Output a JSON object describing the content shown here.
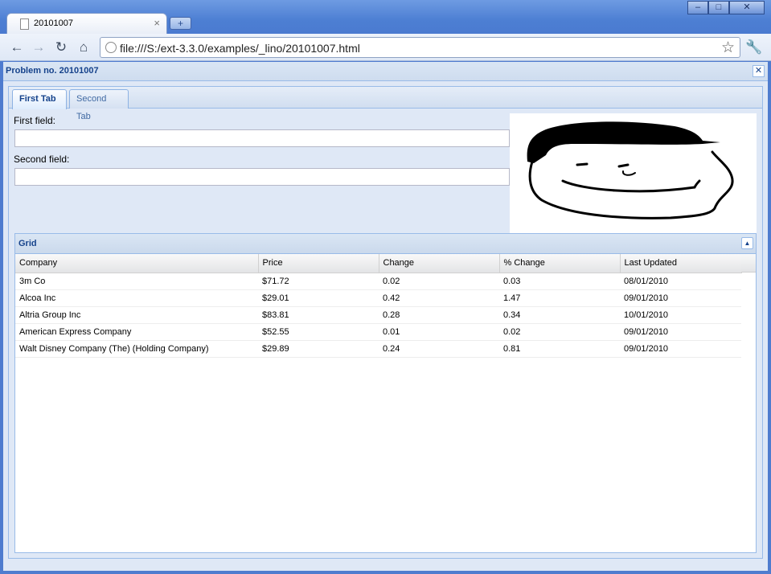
{
  "browser": {
    "tab_title": "20101007",
    "tab_close": "×",
    "new_tab": "+",
    "url": "file:///S:/ext-3.3.0/examples/_lino/20101007.html",
    "window_buttons": {
      "minimize": "–",
      "maximize": "□",
      "close": "✕"
    }
  },
  "panel": {
    "title": "Problem no. 20101007",
    "close": "✕"
  },
  "tabs": [
    {
      "label": "First Tab",
      "active": true
    },
    {
      "label": "Second Tab",
      "active": false
    }
  ],
  "form": {
    "first_label": "First field:",
    "first_value": "",
    "second_label": "Second field:",
    "second_value": ""
  },
  "grid": {
    "title": "Grid",
    "columns": [
      "Company",
      "Price",
      "Change",
      "% Change",
      "Last Updated"
    ],
    "rows": [
      [
        "3m Co",
        "$71.72",
        "0.02",
        "0.03",
        "08/01/2010"
      ],
      [
        "Alcoa Inc",
        "$29.01",
        "0.42",
        "1.47",
        "09/01/2010"
      ],
      [
        "Altria Group Inc",
        "$83.81",
        "0.28",
        "0.34",
        "10/01/2010"
      ],
      [
        "American Express Company",
        "$52.55",
        "0.01",
        "0.02",
        "09/01/2010"
      ],
      [
        "Walt Disney Company (The) (Holding Company)",
        "$29.89",
        "0.24",
        "0.81",
        "09/01/2010"
      ]
    ]
  },
  "icons": [
    "page-icon",
    "back-icon",
    "forward-icon",
    "reload-icon",
    "home-icon",
    "globe-icon",
    "star-icon",
    "wrench-icon",
    "close-icon",
    "collapse-icon"
  ],
  "colors": {
    "accent": "#15428b",
    "panel_bg": "#dfe8f6",
    "border": "#99bbe8"
  }
}
